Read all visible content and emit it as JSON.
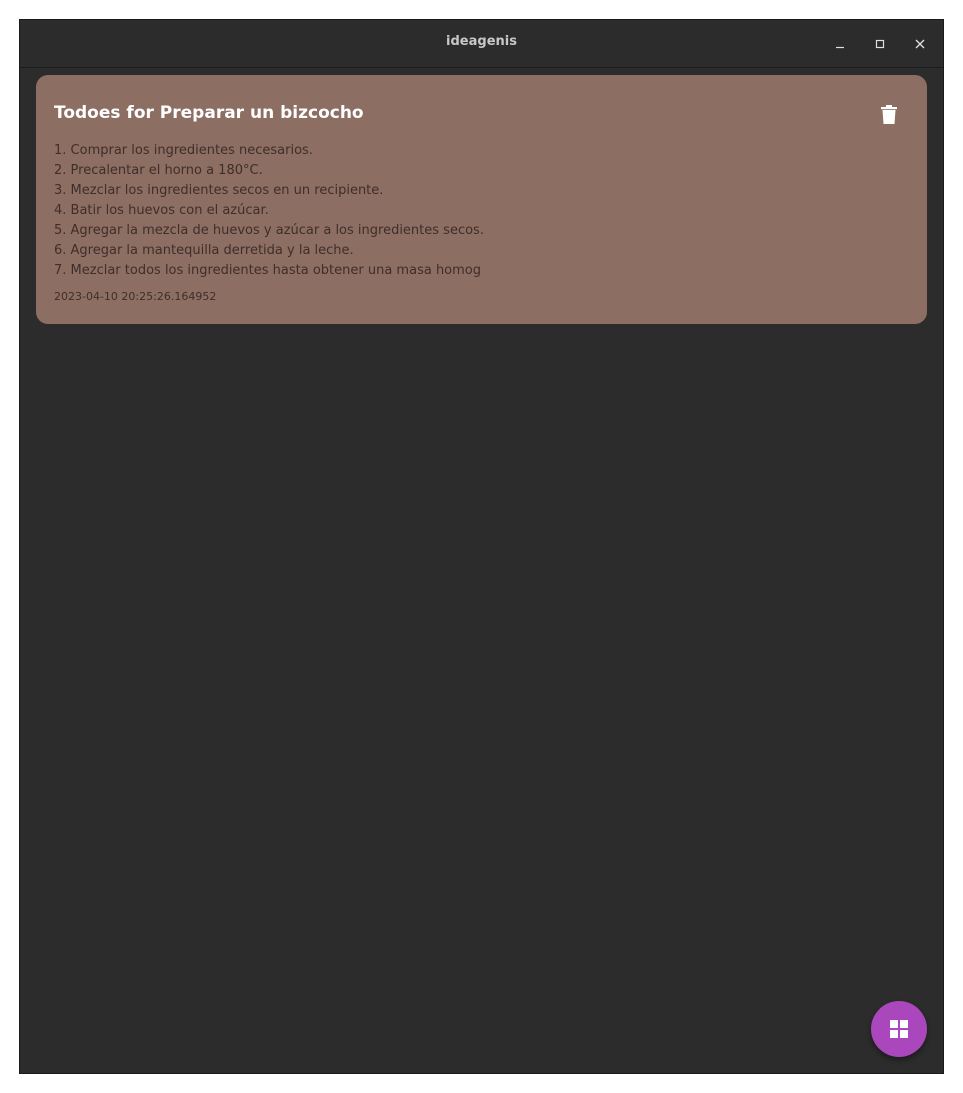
{
  "window": {
    "title": "ideagenis",
    "controls": {
      "minimize_icon": "minimize-icon",
      "maximize_icon": "maximize-icon",
      "close_icon": "close-icon"
    }
  },
  "colors": {
    "window_bg": "#2c2c2c",
    "card_bg": "#8d6e63",
    "fab_bg": "#ab47bc",
    "title_text": "#ffffff",
    "body_text": "#3f2e29"
  },
  "cards": [
    {
      "title": "Todoes for Preparar un bizcocho",
      "delete_icon": "trash-icon",
      "steps": [
        "1. Comprar los ingredientes necesarios.",
        "2. Precalentar el horno a 180°C.",
        "3. Mezclar los ingredientes secos en un recipiente.",
        "4. Batir los huevos con el azúcar.",
        "5. Agregar la mezcla de huevos y azúcar a los ingredientes secos.",
        "6. Agregar la mantequilla derretida y la leche.",
        "7. Mezclar todos los ingredientes hasta obtener una masa homog"
      ],
      "timestamp": "2023-04-10 20:25:26.164952"
    }
  ],
  "fab": {
    "icon": "grid-icon"
  }
}
